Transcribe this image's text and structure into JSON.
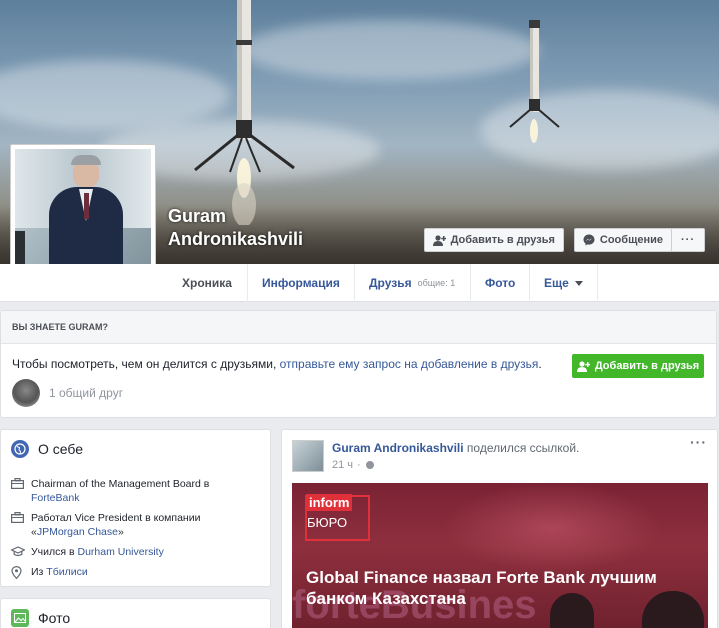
{
  "profile": {
    "name_line1": "Guram",
    "name_line2": "Andronikashvili"
  },
  "cover_buttons": {
    "add_friend": "Добавить в друзья",
    "message": "Сообщение",
    "more": "···"
  },
  "nav": {
    "tabs": [
      {
        "label": "Хроника"
      },
      {
        "label": "Информация"
      },
      {
        "label": "Друзья",
        "sub": "общие: 1"
      },
      {
        "label": "Фото"
      },
      {
        "label": "Еще"
      }
    ]
  },
  "know_card": {
    "title": "ВЫ ЗНАЕТЕ GURAM?",
    "text_plain": "Чтобы посмотреть, чем он делится с друзьями, ",
    "text_link": "отправьте ему запрос на добавление в друзья",
    "text_end": ".",
    "button": "Добавить в друзья",
    "mutual": "1 общий друг"
  },
  "about": {
    "title": "О себе",
    "rows": [
      {
        "prefix": "Chairman of the Management Board в ",
        "link": "ForteBank",
        "icon": "briefcase-icon"
      },
      {
        "prefix": "Работал Vice President в компании ",
        "link": "JPMorgan Chase",
        "quote_open": "«",
        "quote_close": "»",
        "icon": "briefcase-icon"
      },
      {
        "prefix": "Учился в ",
        "link": "Durham University",
        "icon": "graduation-cap-icon"
      },
      {
        "prefix": "Из ",
        "link": "Тбилиси",
        "icon": "location-pin-icon"
      }
    ]
  },
  "photos": {
    "title": "Фото"
  },
  "post": {
    "author": "Guram Andronikashvili",
    "action": " поделился ссылкой.",
    "time": "21 ч",
    "more": "···",
    "news": {
      "logo_top": "inform",
      "logo_bottom": "БЮРО",
      "headline": "Global Finance назвал Forte Bank лучшим банком Казахстана",
      "watermark": "forteBusines"
    }
  },
  "colors": {
    "link": "#365899",
    "green": "#42b72a",
    "news_bg": "#7a2334",
    "logo_red": "#e0313a"
  }
}
